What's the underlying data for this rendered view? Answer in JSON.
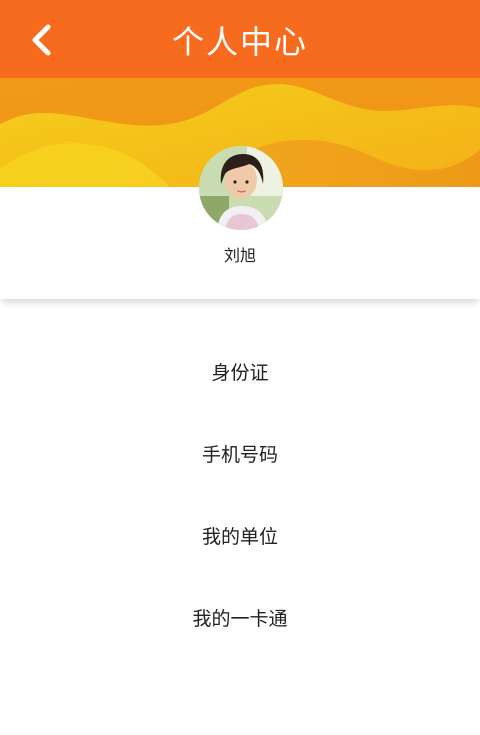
{
  "header": {
    "title": "个人中心",
    "back_icon": "chevron-left-icon",
    "background_color": "#f76b1f"
  },
  "profile": {
    "name": "刘旭",
    "avatar_icon": "user-avatar"
  },
  "menu": {
    "items": [
      {
        "label": "身份证"
      },
      {
        "label": "手机号码"
      },
      {
        "label": "我的单位"
      },
      {
        "label": "我的一卡通"
      }
    ]
  },
  "colors": {
    "accent": "#f76b1f",
    "banner_yellow": "#f5c518",
    "banner_orange": "#f0a020"
  }
}
